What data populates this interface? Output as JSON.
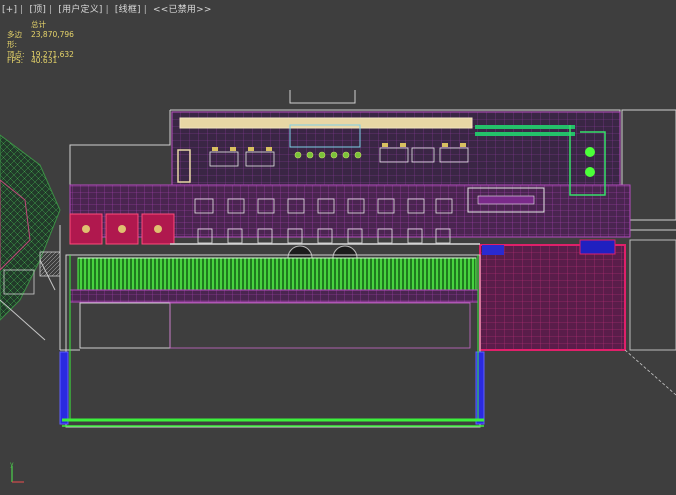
{
  "viewport": {
    "label_parts": [
      "[+]",
      "[顶]",
      "[用户定义]",
      "[线框]",
      "<<已禁用>>"
    ],
    "separator": "|"
  },
  "stats": {
    "total_label": "总计",
    "polys_label": "多边形:",
    "polys_value": "23,870,796",
    "verts_label": "顶点:",
    "verts_value": "19,271,632",
    "fps_label": "FPS:",
    "fps_value": "40.631"
  },
  "colors": {
    "background": "#3e3e3e",
    "stats_text": "#e6d46a",
    "wire_magenta": "#c13bb0",
    "wire_green": "#38e03a",
    "wire_blue": "#3c3cff",
    "wire_white": "#e6e6e6"
  },
  "icons": {
    "axis_gizmo": "axis-gizmo-icon"
  }
}
